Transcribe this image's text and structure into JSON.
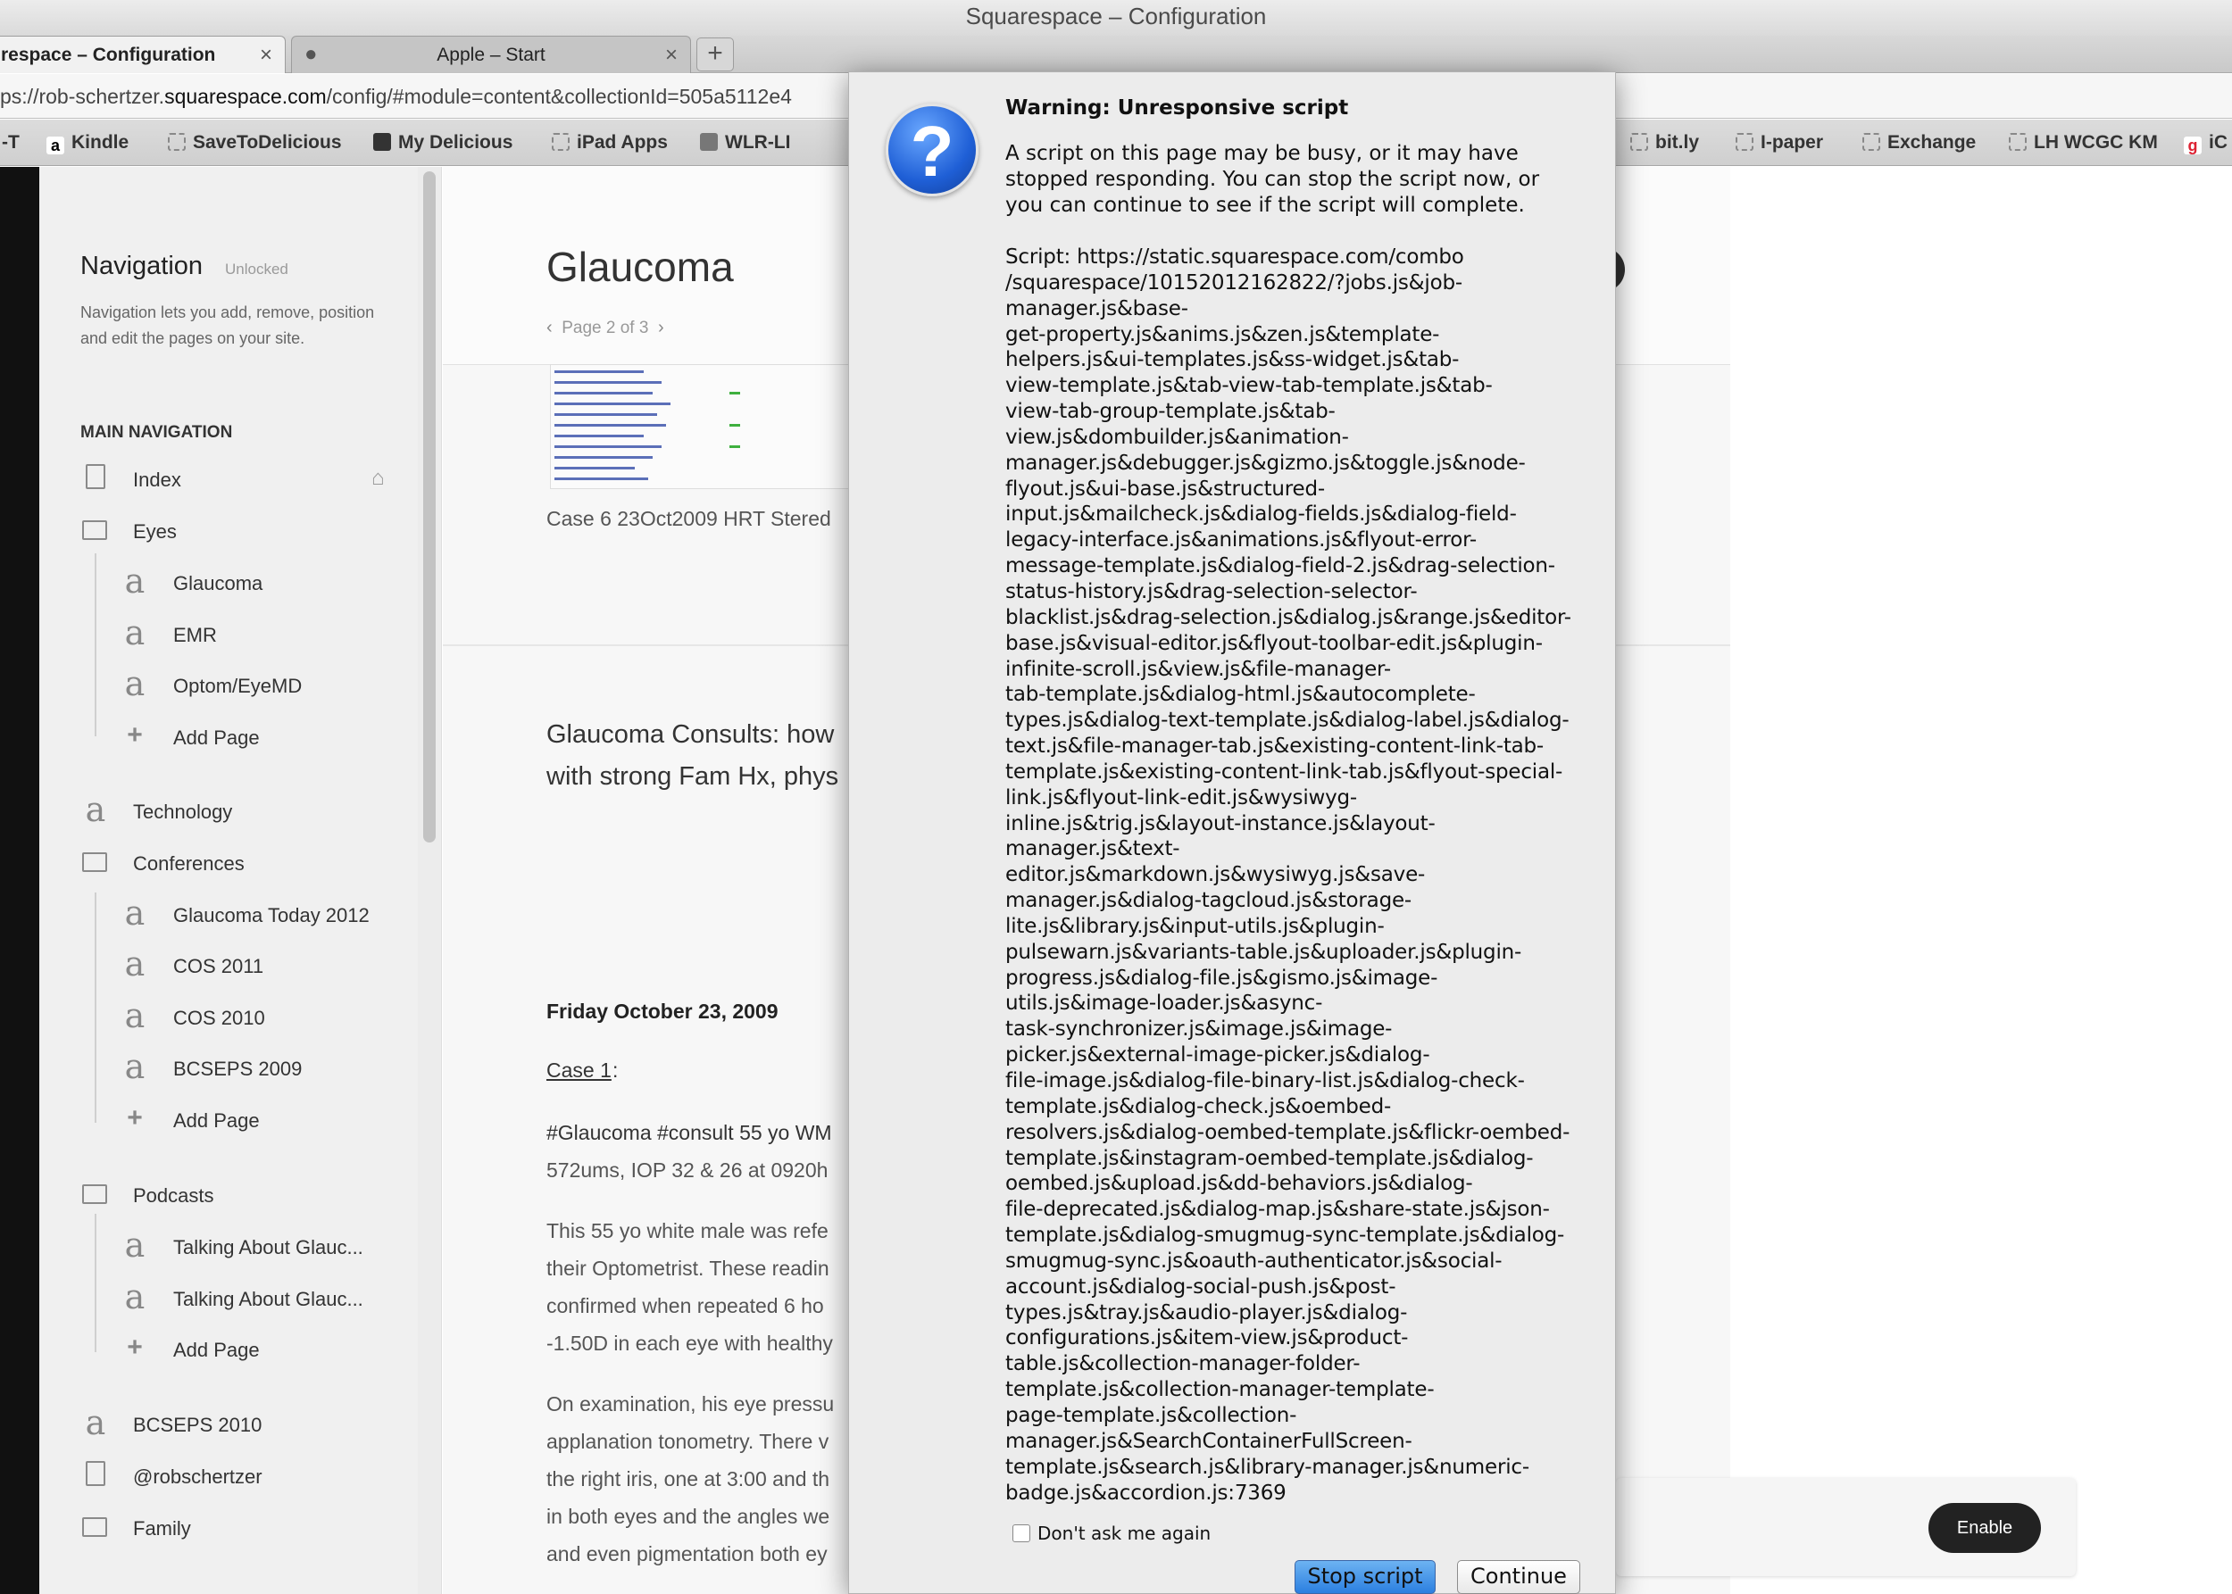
{
  "window": {
    "title": "Squarespace – Configuration"
  },
  "tabs": [
    {
      "label": "respace – Configuration",
      "close": "×"
    },
    {
      "label": "Apple – Start",
      "close": "×"
    }
  ],
  "new_tab": "+",
  "address_bar": {
    "url_prefix": "ps://rob-schertzer.",
    "url_domain": "squarespace.com",
    "url_suffix": "/config/#module=content&collectionId=505a5112e4"
  },
  "bookmarks": [
    "-T",
    "Kindle",
    "SaveToDelicious",
    "My Delicious",
    "iPad Apps",
    "WLR-LI",
    "bit.ly",
    "I-paper",
    "Exchange",
    "LH WCGC KM",
    "iC"
  ],
  "sidebar": {
    "title": "Navigation",
    "status": "Unlocked",
    "description": "Navigation lets you add, remove, position and edit the pages on your site.",
    "section_title": "MAIN NAVIGATION",
    "items": [
      {
        "label": "Index"
      },
      {
        "label": "Eyes"
      },
      {
        "label": "Glaucoma"
      },
      {
        "label": "EMR"
      },
      {
        "label": "Optom/EyeMD"
      },
      {
        "label": "Add Page"
      },
      {
        "label": "Technology"
      },
      {
        "label": "Conferences"
      },
      {
        "label": "Glaucoma Today 2012"
      },
      {
        "label": "COS 2011"
      },
      {
        "label": "COS 2010"
      },
      {
        "label": "BCSEPS 2009"
      },
      {
        "label": "Add Page"
      },
      {
        "label": "Podcasts"
      },
      {
        "label": "Talking About Glauc..."
      },
      {
        "label": "Talking About Glauc..."
      },
      {
        "label": "Add Page"
      },
      {
        "label": "BCSEPS 2010"
      },
      {
        "label": "@robschertzer"
      },
      {
        "label": "Family"
      }
    ]
  },
  "editor": {
    "post_title": "Glaucoma",
    "pager": "Page 2 of 3",
    "caption": "Case 6 23Oct2009 HRT Stered",
    "consult_line1": "Glaucoma Consults: how",
    "consult_line2": "with strong Fam Hx, phys",
    "date": "Friday October 23, 2009",
    "case_label": "Case 1",
    "case_colon": ":",
    "para1_line1": "#Glaucoma #consult 55 yo WM",
    "para1_line2": "572ums, IOP 32 & 26 at 0920h",
    "para2": [
      "This 55 yo white male was refe",
      "their Optometrist. These readin",
      "confirmed when repeated 6 ho",
      "-1.50D in each eye with healthy"
    ],
    "para3": [
      "On examination, his eye pressu",
      "applanation tonometry. There v",
      "the right iris, one at 3:00 and th",
      "in both eyes and the angles we",
      "and even pigmentation both ey"
    ]
  },
  "enable_button": "Enable",
  "dialog": {
    "title": "Warning: Unresponsive script",
    "message": [
      "A script on this page may be busy, or it may have",
      "stopped responding. You can stop the script now, or",
      "you can continue to see if the script will complete."
    ],
    "script_lines": [
      "Script: https://static.squarespace.com/combo",
      "/squarespace/10152012162822/?jobs.js&job-",
      "manager.js&base-",
      "get-property.js&anims.js&zen.js&template-",
      "helpers.js&ui-templates.js&ss-widget.js&tab-",
      "view-template.js&tab-view-tab-template.js&tab-",
      "view-tab-group-template.js&tab-",
      "view.js&dombuilder.js&animation-",
      "manager.js&debugger.js&gizmo.js&toggle.js&node-",
      "flyout.js&ui-base.js&structured-",
      "input.js&mailcheck.js&dialog-fields.js&dialog-field-",
      "legacy-interface.js&animations.js&flyout-error-",
      "message-template.js&dialog-field-2.js&drag-selection-",
      "status-history.js&drag-selection-selector-",
      "blacklist.js&drag-selection.js&dialog.js&range.js&editor-",
      "base.js&visual-editor.js&flyout-toolbar-edit.js&plugin-",
      "infinite-scroll.js&view.js&file-manager-",
      "tab-template.js&dialog-html.js&autocomplete-",
      "types.js&dialog-text-template.js&dialog-label.js&dialog-",
      "text.js&file-manager-tab.js&existing-content-link-tab-",
      "template.js&existing-content-link-tab.js&flyout-special-",
      "link.js&flyout-link-edit.js&wysiwyg-",
      "inline.js&trig.js&layout-instance.js&layout-",
      "manager.js&text-",
      "editor.js&markdown.js&wysiwyg.js&save-",
      "manager.js&dialog-tagcloud.js&storage-",
      "lite.js&library.js&input-utils.js&plugin-",
      "pulsewarn.js&variants-table.js&uploader.js&plugin-",
      "progress.js&dialog-file.js&gismo.js&image-",
      "utils.js&image-loader.js&async-",
      "task-synchronizer.js&image.js&image-",
      "picker.js&external-image-picker.js&dialog-",
      "file-image.js&dialog-file-binary-list.js&dialog-check-",
      "template.js&dialog-check.js&oembed-",
      "resolvers.js&dialog-oembed-template.js&flickr-oembed-",
      "template.js&instagram-oembed-template.js&dialog-",
      "oembed.js&upload.js&dd-behaviors.js&dialog-",
      "file-deprecated.js&dialog-map.js&share-state.js&json-",
      "template.js&dialog-smugmug-sync-template.js&dialog-",
      "smugmug-sync.js&oauth-authenticator.js&social-",
      "account.js&dialog-social-push.js&post-",
      "types.js&tray.js&audio-player.js&dialog-",
      "configurations.js&item-view.js&product-",
      "table.js&collection-manager-folder-",
      "template.js&collection-manager-template-",
      "page-template.js&collection-",
      "manager.js&SearchContainerFullScreen-",
      "template.js&search.js&library-manager.js&numeric-",
      "badge.js&accordion.js:7369"
    ],
    "checkbox_label": "Don't ask me again",
    "stop_button": "Stop script",
    "continue_button": "Continue"
  }
}
